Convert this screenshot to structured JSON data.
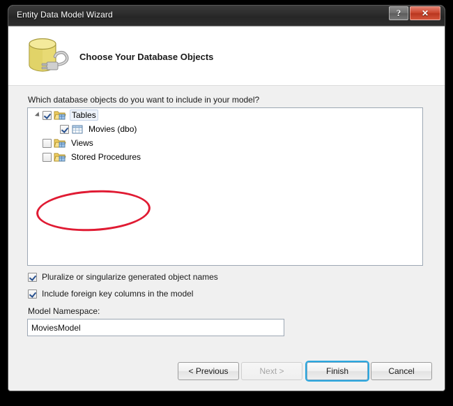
{
  "window": {
    "title": "Entity Data Model Wizard",
    "help_button": "?",
    "close_button": "✕"
  },
  "header": {
    "icon": "database-cylinder-plug-icon",
    "title": "Choose Your Database Objects"
  },
  "main": {
    "prompt": "Which database objects do you want to include in your model?",
    "tree": [
      {
        "label": "Tables",
        "checked": true,
        "level": 0,
        "expanded": true,
        "selected": true,
        "icon": "tables-folder-icon"
      },
      {
        "label": "Movies (dbo)",
        "checked": true,
        "level": 1,
        "expanded": false,
        "selected": false,
        "icon": "table-grid-icon"
      },
      {
        "label": "Views",
        "checked": false,
        "level": 0,
        "expanded": false,
        "selected": false,
        "icon": "views-folder-icon"
      },
      {
        "label": "Stored Procedures",
        "checked": false,
        "level": 0,
        "expanded": false,
        "selected": false,
        "icon": "stored-procedures-folder-icon"
      }
    ],
    "options": [
      {
        "label": "Pluralize or singularize generated object names",
        "checked": true
      },
      {
        "label": "Include foreign key columns in the model",
        "checked": true
      }
    ],
    "namespace": {
      "label": "Model Namespace:",
      "value": "MoviesModel",
      "placeholder": ""
    }
  },
  "footer": {
    "previous": "< Previous",
    "next": "Next >",
    "finish": "Finish",
    "cancel": "Cancel"
  },
  "annotation": {
    "shape": "red-ellipse-highlight"
  },
  "colors": {
    "titlebar": "#2b2b2b",
    "body": "#f0f0f0",
    "accent": "#2ba8e0",
    "close_red": "#c9442c",
    "annotation_red": "#e01b33",
    "db_icon_yellow": "#e3d46a"
  }
}
